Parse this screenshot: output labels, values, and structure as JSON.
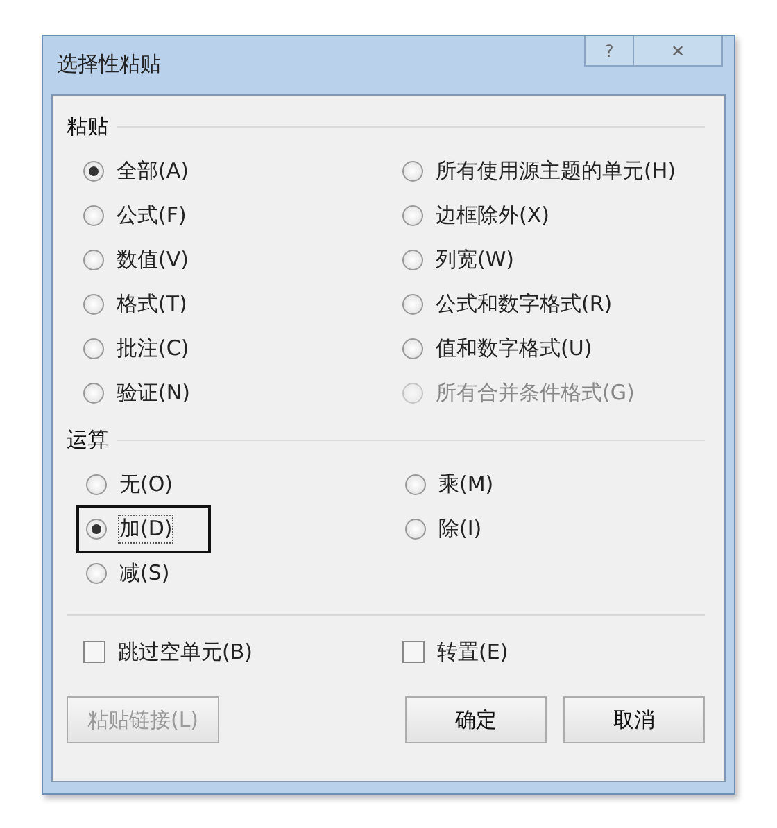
{
  "window": {
    "title": "选择性粘贴",
    "help_button": "?",
    "close_button": "✕"
  },
  "paste": {
    "heading": "粘贴",
    "options": [
      {
        "label": "全部(A)",
        "selected": true,
        "disabled": false
      },
      {
        "label": "所有使用源主题的单元(H)",
        "selected": false,
        "disabled": false
      },
      {
        "label": "公式(F)",
        "selected": false,
        "disabled": false
      },
      {
        "label": "边框除外(X)",
        "selected": false,
        "disabled": false
      },
      {
        "label": "数值(V)",
        "selected": false,
        "disabled": false
      },
      {
        "label": "列宽(W)",
        "selected": false,
        "disabled": false
      },
      {
        "label": "格式(T)",
        "selected": false,
        "disabled": false
      },
      {
        "label": "公式和数字格式(R)",
        "selected": false,
        "disabled": false
      },
      {
        "label": "批注(C)",
        "selected": false,
        "disabled": false
      },
      {
        "label": "值和数字格式(U)",
        "selected": false,
        "disabled": false
      },
      {
        "label": "验证(N)",
        "selected": false,
        "disabled": false
      },
      {
        "label": "所有合并条件格式(G)",
        "selected": false,
        "disabled": true
      }
    ]
  },
  "operation": {
    "heading": "运算",
    "options": [
      {
        "label": "无(O)",
        "selected": false,
        "highlighted": false
      },
      {
        "label": "乘(M)",
        "selected": false,
        "highlighted": false
      },
      {
        "label": "加(D)",
        "selected": true,
        "highlighted": true
      },
      {
        "label": "除(I)",
        "selected": false,
        "highlighted": false
      },
      {
        "label": "减(S)",
        "selected": false,
        "highlighted": false
      }
    ]
  },
  "checkboxes": [
    {
      "label": "跳过空单元(B)",
      "checked": false
    },
    {
      "label": "转置(E)",
      "checked": false
    }
  ],
  "buttons": [
    {
      "label": "粘贴链接(L)",
      "disabled": true
    },
    {
      "label": "确定",
      "disabled": false
    },
    {
      "label": "取消",
      "disabled": false
    }
  ]
}
